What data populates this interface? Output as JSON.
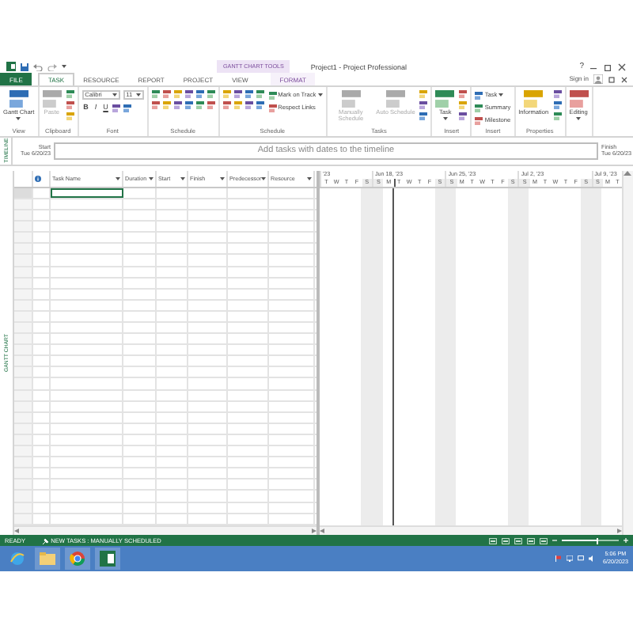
{
  "title_bar": {
    "contextual_tab": "GANTT CHART TOOLS",
    "title": "Project1 - Project Professional",
    "help": "?"
  },
  "tabs": [
    {
      "label": "FILE",
      "kind": "file",
      "selected": false
    },
    {
      "label": "TASK",
      "kind": "normal",
      "selected": true
    },
    {
      "label": "RESOURCE",
      "kind": "normal",
      "selected": false
    },
    {
      "label": "REPORT",
      "kind": "normal",
      "selected": false
    },
    {
      "label": "PROJECT",
      "kind": "normal",
      "selected": false
    },
    {
      "label": "VIEW",
      "kind": "normal",
      "selected": false
    },
    {
      "label": "FORMAT",
      "kind": "contextual",
      "selected": false
    }
  ],
  "sign_in": "Sign in",
  "ribbon": [
    {
      "label": "View",
      "items": [
        {
          "kind": "big",
          "label": "Gantt Chart",
          "dropdown": true,
          "disabled": false
        }
      ]
    },
    {
      "label": "Clipboard",
      "items": [
        {
          "kind": "big",
          "label": "Paste",
          "dropdown": false,
          "disabled": true
        },
        {
          "kind": "stack",
          "rows": [
            {
              "controls": [
                {
                  "kind": "icon"
                }
              ]
            },
            {
              "controls": [
                {
                  "kind": "icon"
                }
              ]
            },
            {
              "controls": [
                {
                  "kind": "icon"
                }
              ]
            }
          ]
        }
      ]
    },
    {
      "label": "Font",
      "items": [
        {
          "kind": "stack",
          "rows": [
            {
              "controls": [
                {
                  "kind": "dropdown",
                  "value": "Calibri"
                },
                {
                  "kind": "dropdown",
                  "value": "11"
                }
              ]
            },
            {
              "controls": [
                {
                  "kind": "format",
                  "label": "B"
                },
                {
                  "kind": "format",
                  "label": "I"
                },
                {
                  "kind": "format",
                  "label": "U"
                },
                {
                  "kind": "icon"
                },
                {
                  "kind": "icon"
                }
              ]
            }
          ]
        }
      ]
    },
    {
      "label": "Schedule",
      "items": [
        {
          "kind": "stack",
          "rows": [
            {
              "controls": [
                {
                  "kind": "icon"
                },
                {
                  "kind": "icon"
                },
                {
                  "kind": "icon"
                },
                {
                  "kind": "icon"
                },
                {
                  "kind": "icon"
                },
                {
                  "kind": "icon"
                }
              ]
            },
            {
              "controls": [
                {
                  "kind": "icon"
                },
                {
                  "kind": "icon"
                },
                {
                  "kind": "icon"
                },
                {
                  "kind": "icon"
                },
                {
                  "kind": "icon"
                },
                {
                  "kind": "icon"
                }
              ]
            }
          ]
        }
      ]
    },
    {
      "label": "Schedule",
      "items": [
        {
          "kind": "stack",
          "rows": [
            {
              "controls": [
                {
                  "kind": "icon"
                },
                {
                  "kind": "icon"
                },
                {
                  "kind": "icon"
                },
                {
                  "kind": "icon"
                }
              ]
            },
            {
              "controls": [
                {
                  "kind": "icon"
                },
                {
                  "kind": "icon"
                },
                {
                  "kind": "icon"
                },
                {
                  "kind": "icon"
                }
              ]
            }
          ]
        },
        {
          "kind": "stack",
          "rows": [
            {
              "controls": [
                {
                  "kind": "small",
                  "label": "Mark on Track",
                  "dropdown": true
                }
              ]
            },
            {
              "controls": [
                {
                  "kind": "small",
                  "label": "Respect Links",
                  "dropdown": false
                }
              ]
            }
          ]
        }
      ]
    },
    {
      "label": "Tasks",
      "items": [
        {
          "kind": "big",
          "label": "Manually Schedule",
          "dropdown": false,
          "disabled": true
        },
        {
          "kind": "big",
          "label": "Auto Schedule",
          "dropdown": false,
          "disabled": true
        },
        {
          "kind": "stack",
          "rows": [
            {
              "controls": [
                {
                  "kind": "icon"
                }
              ]
            },
            {
              "controls": [
                {
                  "kind": "icon"
                }
              ]
            },
            {
              "controls": [
                {
                  "kind": "icon"
                }
              ]
            }
          ]
        }
      ]
    },
    {
      "label": "Insert",
      "items": [
        {
          "kind": "big",
          "label": "Task",
          "dropdown": true,
          "disabled": false
        },
        {
          "kind": "stack",
          "rows": [
            {
              "controls": [
                {
                  "kind": "icon"
                }
              ]
            },
            {
              "controls": [
                {
                  "kind": "icon"
                }
              ]
            },
            {
              "controls": [
                {
                  "kind": "icon"
                }
              ]
            }
          ]
        }
      ]
    },
    {
      "label": "Insert",
      "items": [
        {
          "kind": "stack",
          "rows": [
            {
              "controls": [
                {
                  "kind": "small",
                  "label": "Task",
                  "dropdown": true
                }
              ]
            },
            {
              "controls": [
                {
                  "kind": "small",
                  "label": "Summary",
                  "dropdown": false
                }
              ]
            },
            {
              "controls": [
                {
                  "kind": "small",
                  "label": "Milestone",
                  "dropdown": false
                }
              ]
            }
          ]
        }
      ]
    },
    {
      "label": "Properties",
      "items": [
        {
          "kind": "big",
          "label": "Information",
          "dropdown": false,
          "disabled": false
        },
        {
          "kind": "stack",
          "rows": [
            {
              "controls": [
                {
                  "kind": "icon"
                }
              ]
            },
            {
              "controls": [
                {
                  "kind": "icon"
                }
              ]
            },
            {
              "controls": [
                {
                  "kind": "icon"
                }
              ]
            }
          ]
        }
      ]
    },
    {
      "items": [
        {
          "kind": "big",
          "label": "Editing",
          "dropdown": true,
          "disabled": false
        }
      ]
    }
  ],
  "timeline": {
    "label": "TIMELINE",
    "start_label": "Start",
    "start_date": "Tue 6/20/23",
    "placeholder": "Add tasks with dates to the timeline",
    "finish_label": "Finish",
    "finish_date": "Tue 6/20/23"
  },
  "table": {
    "columns": [
      "Task Name",
      "Duration",
      "Start",
      "Finish",
      "Predecessor",
      "Resource"
    ]
  },
  "gantt": {
    "label": "GANTT CHART",
    "weeks": [
      {
        "label": "'23",
        "days": [
          {
            "label": "T",
            "weekend": false,
            "today": false
          },
          {
            "label": "W",
            "weekend": false,
            "today": false
          },
          {
            "label": "T",
            "weekend": false,
            "today": false
          },
          {
            "label": "F",
            "weekend": false,
            "today": false
          },
          {
            "label": "S",
            "weekend": true,
            "today": false
          }
        ]
      },
      {
        "label": "Jun 18, '23",
        "days": [
          {
            "label": "S",
            "weekend": true,
            "today": false
          },
          {
            "label": "M",
            "weekend": false,
            "today": false
          },
          {
            "label": "T",
            "weekend": false,
            "today": true
          },
          {
            "label": "W",
            "weekend": false,
            "today": false
          },
          {
            "label": "T",
            "weekend": false,
            "today": false
          },
          {
            "label": "F",
            "weekend": false,
            "today": false
          },
          {
            "label": "S",
            "weekend": true,
            "today": false
          }
        ]
      },
      {
        "label": "Jun 25, '23",
        "days": [
          {
            "label": "S",
            "weekend": true,
            "today": false
          },
          {
            "label": "M",
            "weekend": false,
            "today": false
          },
          {
            "label": "T",
            "weekend": false,
            "today": false
          },
          {
            "label": "W",
            "weekend": false,
            "today": false
          },
          {
            "label": "T",
            "weekend": false,
            "today": false
          },
          {
            "label": "F",
            "weekend": false,
            "today": false
          },
          {
            "label": "S",
            "weekend": true,
            "today": false
          }
        ]
      },
      {
        "label": "Jul 2, '23",
        "days": [
          {
            "label": "S",
            "weekend": true,
            "today": false
          },
          {
            "label": "M",
            "weekend": false,
            "today": false
          },
          {
            "label": "T",
            "weekend": false,
            "today": false
          },
          {
            "label": "W",
            "weekend": false,
            "today": false
          },
          {
            "label": "T",
            "weekend": false,
            "today": false
          },
          {
            "label": "F",
            "weekend": false,
            "today": false
          },
          {
            "label": "S",
            "weekend": true,
            "today": false
          }
        ]
      },
      {
        "label": "Jul 9, '23",
        "days": [
          {
            "label": "S",
            "weekend": true,
            "today": false
          },
          {
            "label": "M",
            "weekend": false,
            "today": false
          },
          {
            "label": "T",
            "weekend": false,
            "today": false
          }
        ]
      }
    ]
  },
  "status_bar": {
    "ready": "READY",
    "new_tasks": "NEW TASKS : MANUALLY SCHEDULED",
    "zoom": {
      "level": 0.62
    }
  },
  "taskbar": {
    "time": "5:06 PM",
    "date": "6/20/2023"
  }
}
